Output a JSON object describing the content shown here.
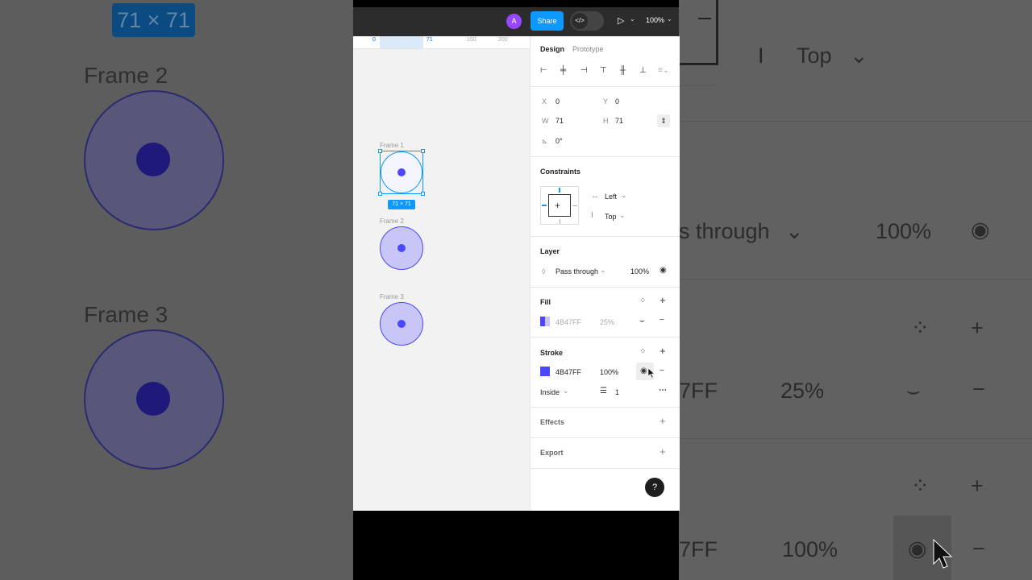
{
  "background": {
    "badge": "71 × 71",
    "frame2": "Frame 2",
    "frame3": "Frame 3",
    "pass_through": "s through",
    "opacity_100": "100%",
    "hex_a": "7FF",
    "opacity_25": "25%",
    "hex_b": "7FF",
    "opacity_100b": "100%",
    "top": "Top",
    "top_partial": "25%"
  },
  "topbar": {
    "avatar": "A",
    "share": "Share",
    "zoom": "100%"
  },
  "ruler": {
    "marks": [
      "0",
      "71",
      "150",
      "200"
    ]
  },
  "canvas": {
    "frames": [
      "Frame 1",
      "Frame 2",
      "Frame 3"
    ],
    "size_badge": "71 × 71"
  },
  "panel": {
    "tabs": [
      "Design",
      "Prototype"
    ],
    "x_label": "X",
    "x_value": "0",
    "y_label": "Y",
    "y_value": "0",
    "w_label": "W",
    "w_value": "71",
    "h_label": "H",
    "h_value": "71",
    "rotation": "0°",
    "constraints_title": "Constraints",
    "constraint_h": "Left",
    "constraint_v": "Top",
    "layer_title": "Layer",
    "blend_mode": "Pass through",
    "layer_opacity": "100%",
    "fill_title": "Fill",
    "fill_hex": "4B47FF",
    "fill_opacity": "25%",
    "stroke_title": "Stroke",
    "stroke_hex": "4B47FF",
    "stroke_opacity": "100%",
    "stroke_position": "Inside",
    "stroke_weight": "1",
    "effects_title": "Effects",
    "export_title": "Export",
    "help": "?"
  },
  "colors": {
    "accent": "#4B47FF",
    "share_button": "#0d99ff",
    "avatar": "#9747ff"
  }
}
